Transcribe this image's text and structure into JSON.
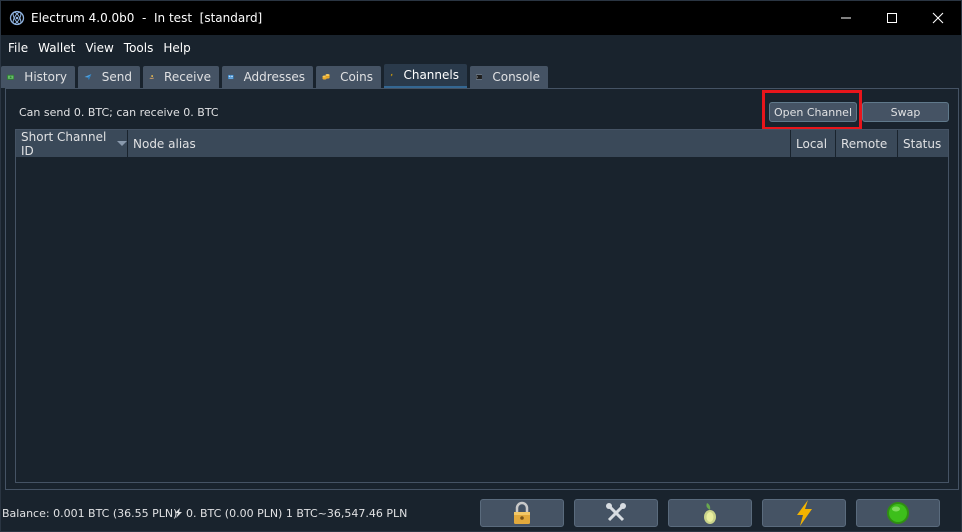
{
  "window": {
    "title": "Electrum 4.0.0b0  -  In test  [standard]"
  },
  "menu": [
    "File",
    "Wallet",
    "View",
    "Tools",
    "Help"
  ],
  "tabs": [
    {
      "label": "History",
      "icon": "history-icon"
    },
    {
      "label": "Send",
      "icon": "send-icon"
    },
    {
      "label": "Receive",
      "icon": "receive-icon"
    },
    {
      "label": "Addresses",
      "icon": "addresses-icon"
    },
    {
      "label": "Coins",
      "icon": "coins-icon"
    },
    {
      "label": "Channels",
      "icon": "lightning-icon",
      "active": true
    },
    {
      "label": "Console",
      "icon": "console-icon"
    }
  ],
  "channels": {
    "capacity_text": "Can send 0. BTC; can receive 0. BTC",
    "open_channel_label": "Open Channel",
    "swap_label": "Swap",
    "columns": [
      "Short Channel ID",
      "Node alias",
      "Local",
      "Remote",
      "Status"
    ],
    "rows": []
  },
  "statusbar": {
    "balance": "Balance: 0.001 BTC (36.55 PLN)",
    "lightning_balance": "0. BTC (0.00 PLN) 1 BTC~36,547.46 PLN",
    "buttons": [
      "lock-icon",
      "tools-icon",
      "seed-icon",
      "lightning-icon",
      "network-status-icon"
    ]
  },
  "colors": {
    "background": "#19232d",
    "tab": "#455364",
    "highlight": "#e8151b",
    "status_green": "#3dbf1b",
    "lightning": "#f4b400"
  }
}
